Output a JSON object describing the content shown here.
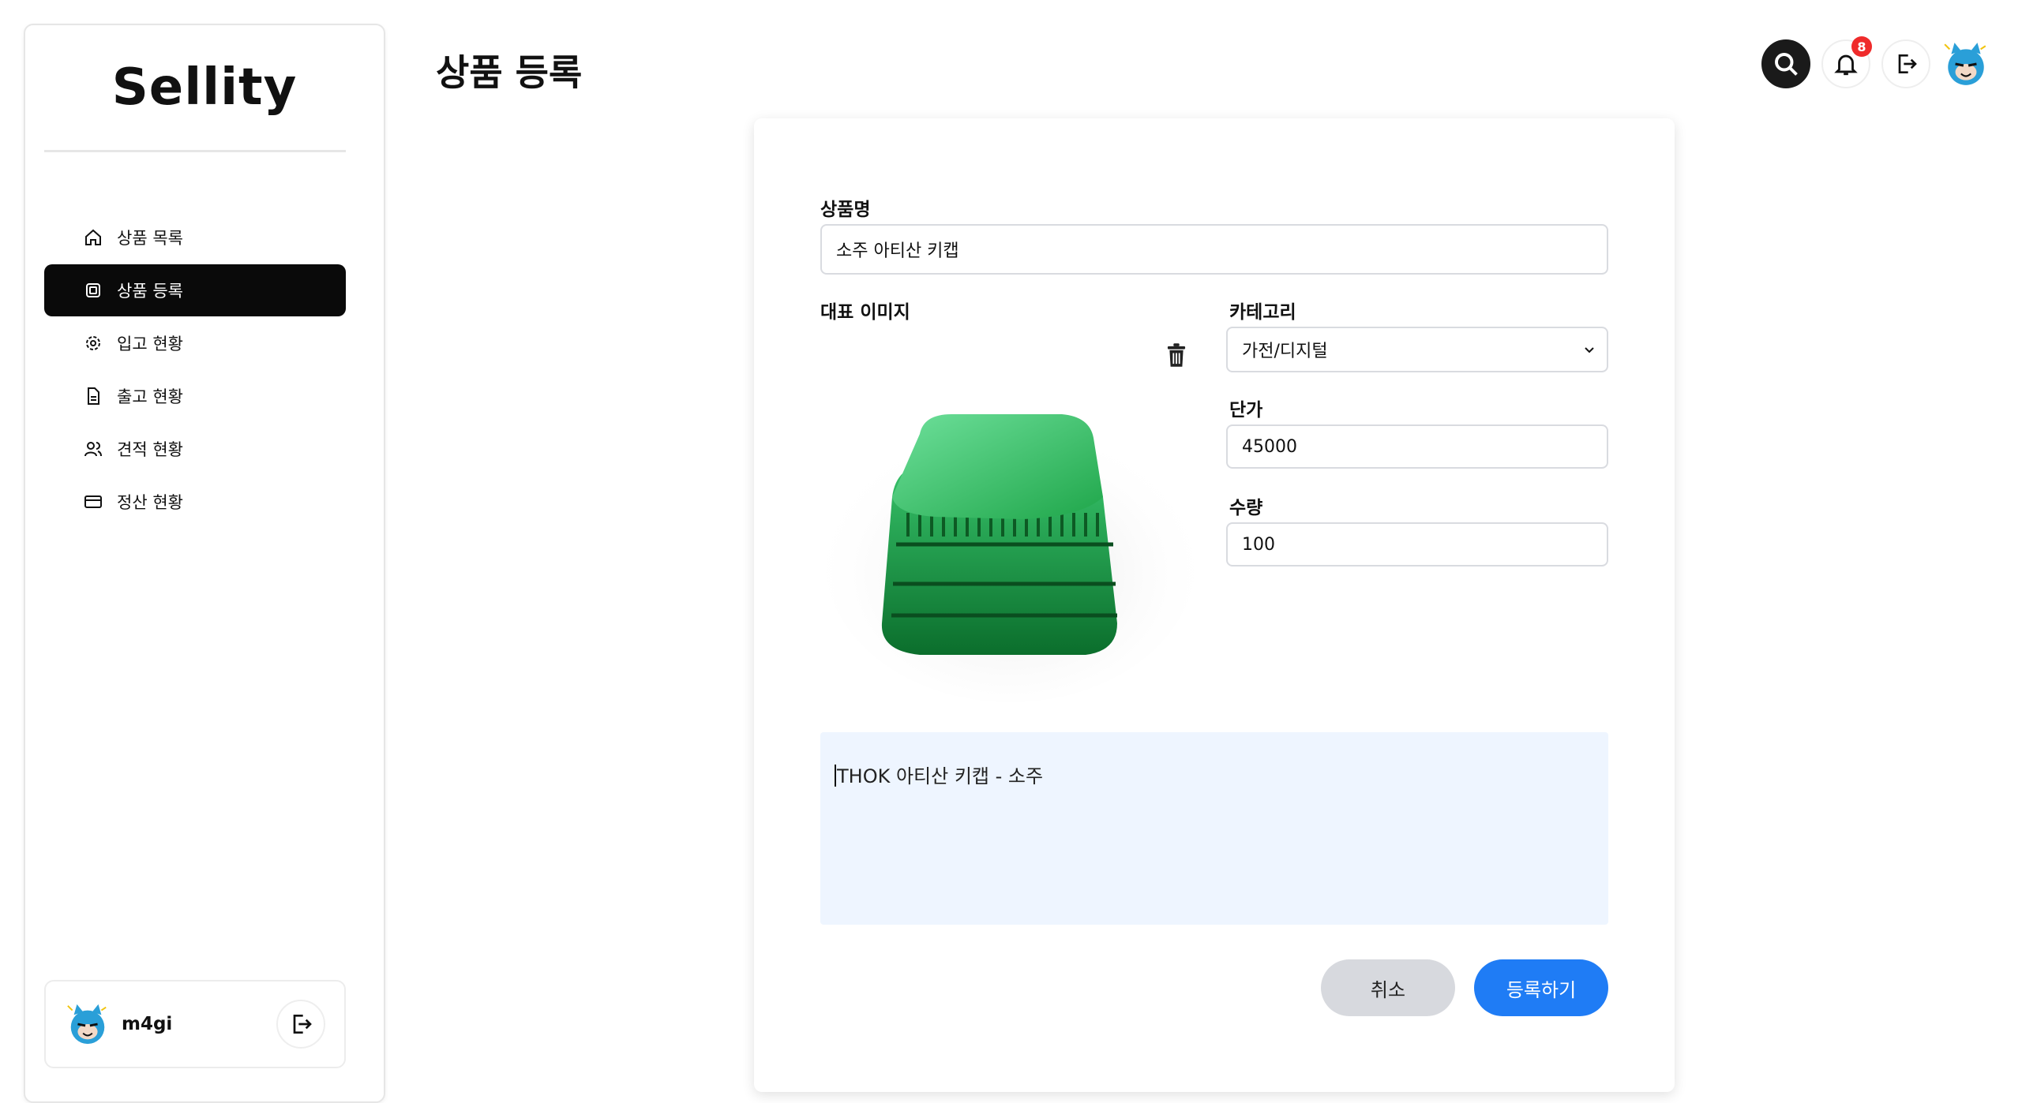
{
  "app": {
    "logo": "Sellity",
    "page_title": "상품 등록"
  },
  "sidebar": {
    "items": [
      {
        "label": "상품 목록",
        "icon": "home-icon",
        "active": false
      },
      {
        "label": "상품 등록",
        "icon": "chip-icon",
        "active": true
      },
      {
        "label": "입고 현황",
        "icon": "gear-icon",
        "active": false
      },
      {
        "label": "출고 현황",
        "icon": "document-icon",
        "active": false
      },
      {
        "label": "견적 현황",
        "icon": "users-icon",
        "active": false
      },
      {
        "label": "정산 현황",
        "icon": "card-icon",
        "active": false
      }
    ],
    "user": {
      "name": "m4gi",
      "avatar": "cat-avatar-icon",
      "logout_icon": "logout-icon"
    }
  },
  "header": {
    "notification_count": "8",
    "icons": [
      "search-icon",
      "bell-icon",
      "logout-icon",
      "cat-avatar-icon"
    ]
  },
  "form": {
    "name_label": "상품명",
    "name_value": "소주 아티산 키캡",
    "image_label": "대표 이미지",
    "category_label": "카테고리",
    "category_value": "가전/디지털",
    "price_label": "단가",
    "price_value": "45000",
    "qty_label": "수량",
    "qty_value": "100",
    "description": "THOK 아티산 키캡 - 소주",
    "cancel_label": "취소",
    "submit_label": "등록하기"
  },
  "colors": {
    "sidebar_active_bg": "#0a0a0a",
    "primary": "#1f7cf5",
    "badge": "#ef2b2b",
    "desc_bg": "#eef5ff",
    "keycap": "#1fa64a"
  }
}
